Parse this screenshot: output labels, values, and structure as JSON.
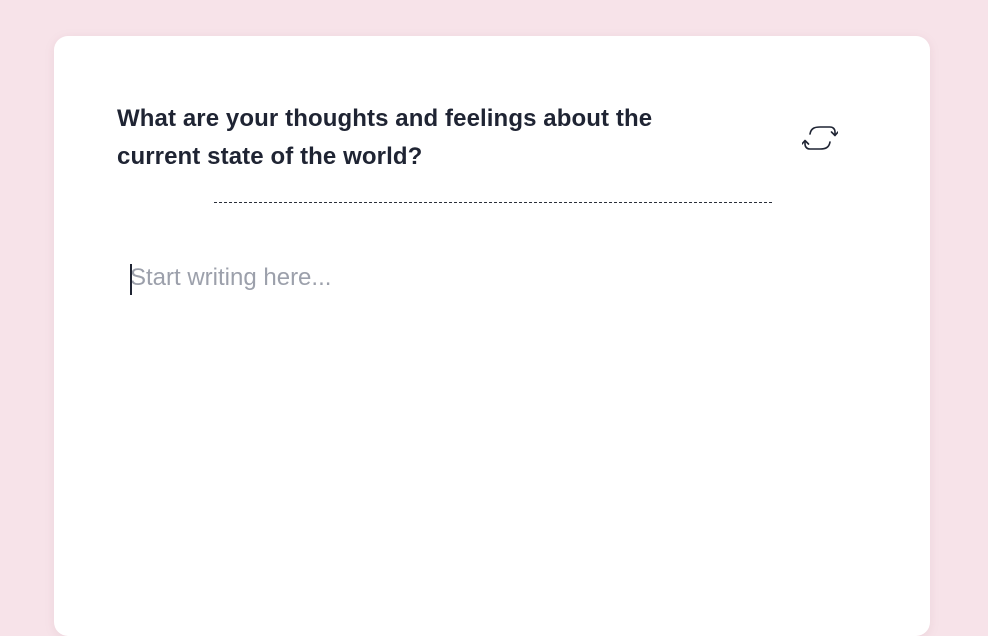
{
  "journal": {
    "prompt": "What are your thoughts and feelings about the current state of the world?",
    "refresh_icon": "refresh-icon",
    "editor": {
      "value": "",
      "placeholder": "Start writing here..."
    }
  },
  "colors": {
    "background": "#f7e3e9",
    "card": "#ffffff",
    "text": "#1f2433",
    "placeholder": "#9ca0ab"
  }
}
